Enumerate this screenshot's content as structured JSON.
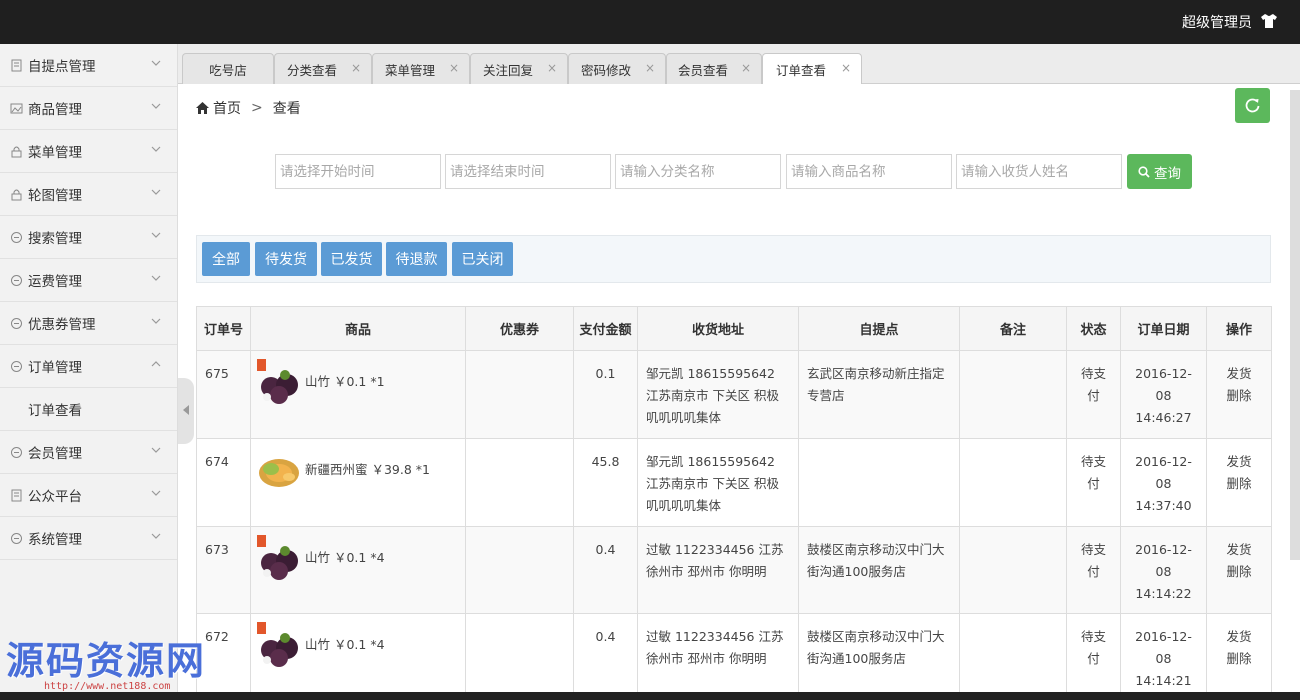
{
  "header": {
    "admin_label": "超级管理员"
  },
  "sidebar": {
    "items": [
      {
        "label": "自提点管理"
      },
      {
        "label": "商品管理"
      },
      {
        "label": "菜单管理"
      },
      {
        "label": "轮图管理"
      },
      {
        "label": "搜索管理"
      },
      {
        "label": "运费管理"
      },
      {
        "label": "优惠券管理"
      },
      {
        "label": "订单管理"
      },
      {
        "label": "会员管理"
      },
      {
        "label": "公众平台"
      },
      {
        "label": "系统管理"
      }
    ],
    "sub_item": "订单查看"
  },
  "tabs": [
    {
      "label": "吃号店"
    },
    {
      "label": "分类查看"
    },
    {
      "label": "菜单管理"
    },
    {
      "label": "关注回复"
    },
    {
      "label": "密码修改"
    },
    {
      "label": "会员查看"
    },
    {
      "label": "订单查看"
    }
  ],
  "breadcrumb": {
    "home": "首页",
    "sep": ">",
    "current": "查看"
  },
  "search": {
    "start_placeholder": "请选择开始时间",
    "end_placeholder": "请选择结束时间",
    "category_placeholder": "请输入分类名称",
    "product_placeholder": "请输入商品名称",
    "receiver_placeholder": "请输入收货人姓名",
    "query_label": "查询"
  },
  "filters": [
    "全部",
    "待发货",
    "已发货",
    "待退款",
    "已关闭"
  ],
  "table": {
    "headers": [
      "订单号",
      "商品",
      "优惠券",
      "支付金额",
      "收货地址",
      "自提点",
      "备注",
      "状态",
      "订单日期",
      "操作"
    ],
    "rows": [
      {
        "id": "675",
        "product": "山竹 ￥0.1 *1",
        "coupon": "",
        "amount": "0.1",
        "address": "邹元凯 18615595642 江苏南京市 下关区 积极叽叽叽叽集体",
        "pickup": "玄武区南京移动新庄指定专营店",
        "note": "",
        "status": "待支付",
        "date": "2016-12-08",
        "time": "14:46:27",
        "op1": "发货",
        "op2": "删除"
      },
      {
        "id": "674",
        "product": "新疆西州蜜 ￥39.8 *1",
        "coupon": "",
        "amount": "45.8",
        "address": "邹元凯 18615595642 江苏南京市 下关区 积极叽叽叽叽集体",
        "pickup": "",
        "note": "",
        "status": "待支付",
        "date": "2016-12-08",
        "time": "14:37:40",
        "op1": "发货",
        "op2": "删除"
      },
      {
        "id": "673",
        "product": "山竹 ￥0.1 *4",
        "coupon": "",
        "amount": "0.4",
        "address": "过敏 1122334456 江苏 徐州市 邳州市 你明明",
        "pickup": "鼓楼区南京移动汉中门大街沟通100服务店",
        "note": "",
        "status": "待支付",
        "date": "2016-12-08",
        "time": "14:14:22",
        "op1": "发货",
        "op2": "删除"
      },
      {
        "id": "672",
        "product": "山竹 ￥0.1 *4",
        "coupon": "",
        "amount": "0.4",
        "address": "过敏 1122334456 江苏 徐州市 邳州市 你明明",
        "pickup": "鼓楼区南京移动汉中门大街沟通100服务店",
        "note": "",
        "status": "待支付",
        "date": "2016-12-08",
        "time": "14:14:21",
        "op1": "发货",
        "op2": "删除"
      }
    ]
  },
  "watermark": {
    "text": "源码资源网",
    "url": "http://www.net188.com"
  },
  "colors": {
    "accent_green": "#5cb85c",
    "filter_blue": "#5b9bd5",
    "topbar": "#1f1f1f"
  }
}
